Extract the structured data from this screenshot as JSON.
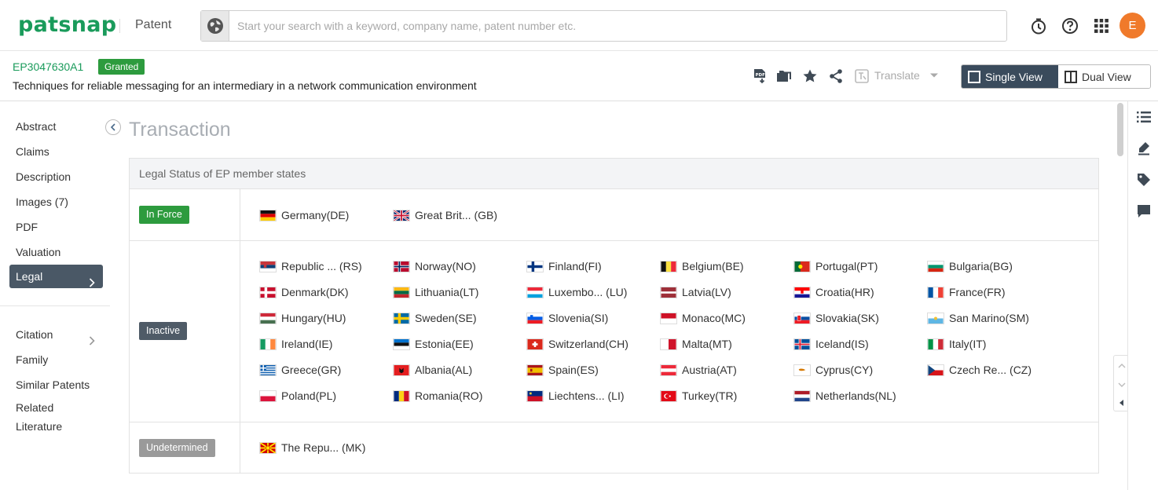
{
  "app": {
    "logo": "patsnap",
    "product": "Patent"
  },
  "search": {
    "placeholder": "Start your search with a keyword, company name, patent number etc.",
    "value": ""
  },
  "user": {
    "initial": "E"
  },
  "patent": {
    "number": "EP3047630A1",
    "status": "Granted",
    "title": "Techniques for reliable messaging for an intermediary in a network communication environment"
  },
  "toolbar": {
    "translate_label": "Translate"
  },
  "view_toggle": {
    "single": "Single View",
    "dual": "Dual View"
  },
  "nav": {
    "items": [
      {
        "label": "Abstract"
      },
      {
        "label": "Claims"
      },
      {
        "label": "Description"
      },
      {
        "label": "Images (7)"
      },
      {
        "label": "PDF"
      },
      {
        "label": "Valuation"
      },
      {
        "label": "Legal"
      }
    ],
    "items2": [
      {
        "label": "Citation"
      },
      {
        "label": "Family"
      },
      {
        "label": "Similar Patents"
      },
      {
        "label": "Related"
      },
      {
        "label": "Literature"
      }
    ]
  },
  "main": {
    "section_title": "Transaction",
    "table_heading": "Legal Status of EP member states",
    "groups": [
      {
        "status": "In Force",
        "color": "#2d9b3e",
        "countries": [
          {
            "name": "Germany(DE)",
            "flag": "de"
          },
          {
            "name": "Great Brit... (GB)",
            "flag": "gb"
          }
        ]
      },
      {
        "status": "Inactive",
        "color": "#4f5b67",
        "countries": [
          {
            "name": "Republic ... (RS)",
            "flag": "rs"
          },
          {
            "name": "Norway(NO)",
            "flag": "no"
          },
          {
            "name": "Finland(FI)",
            "flag": "fi"
          },
          {
            "name": "Belgium(BE)",
            "flag": "be"
          },
          {
            "name": "Portugal(PT)",
            "flag": "pt"
          },
          {
            "name": "Bulgaria(BG)",
            "flag": "bg"
          },
          {
            "name": "Denmark(DK)",
            "flag": "dk"
          },
          {
            "name": "Lithuania(LT)",
            "flag": "lt"
          },
          {
            "name": "Luxembo... (LU)",
            "flag": "lu"
          },
          {
            "name": "Latvia(LV)",
            "flag": "lv"
          },
          {
            "name": "Croatia(HR)",
            "flag": "hr"
          },
          {
            "name": "France(FR)",
            "flag": "fr"
          },
          {
            "name": "Hungary(HU)",
            "flag": "hu"
          },
          {
            "name": "Sweden(SE)",
            "flag": "se"
          },
          {
            "name": "Slovenia(SI)",
            "flag": "si"
          },
          {
            "name": "Monaco(MC)",
            "flag": "mc"
          },
          {
            "name": "Slovakia(SK)",
            "flag": "sk"
          },
          {
            "name": "San Marino(SM)",
            "flag": "sm"
          },
          {
            "name": "Ireland(IE)",
            "flag": "ie"
          },
          {
            "name": "Estonia(EE)",
            "flag": "ee"
          },
          {
            "name": "Switzerland(CH)",
            "flag": "ch"
          },
          {
            "name": "Malta(MT)",
            "flag": "mt"
          },
          {
            "name": "Iceland(IS)",
            "flag": "is"
          },
          {
            "name": "Italy(IT)",
            "flag": "it"
          },
          {
            "name": "Greece(GR)",
            "flag": "gr"
          },
          {
            "name": "Albania(AL)",
            "flag": "al"
          },
          {
            "name": "Spain(ES)",
            "flag": "es"
          },
          {
            "name": "Austria(AT)",
            "flag": "at"
          },
          {
            "name": "Cyprus(CY)",
            "flag": "cy"
          },
          {
            "name": "Czech Re... (CZ)",
            "flag": "cz"
          },
          {
            "name": "Poland(PL)",
            "flag": "pl"
          },
          {
            "name": "Romania(RO)",
            "flag": "ro"
          },
          {
            "name": "Liechtens... (LI)",
            "flag": "li"
          },
          {
            "name": "Turkey(TR)",
            "flag": "tr"
          },
          {
            "name": "Netherlands(NL)",
            "flag": "nl"
          }
        ]
      },
      {
        "status": "Undetermined",
        "color": "#9a9a9a",
        "countries": [
          {
            "name": "The Repu... (MK)",
            "flag": "mk"
          }
        ]
      }
    ]
  },
  "icons": {
    "topbar": [
      "timer-icon",
      "help-icon",
      "apps-grid-icon"
    ],
    "actions": [
      "pdf-download-icon",
      "folder-icon",
      "star-icon",
      "share-icon",
      "translate-icon"
    ],
    "rail": [
      "list-icon",
      "highlighter-icon",
      "tag-icon",
      "comment-icon"
    ]
  }
}
